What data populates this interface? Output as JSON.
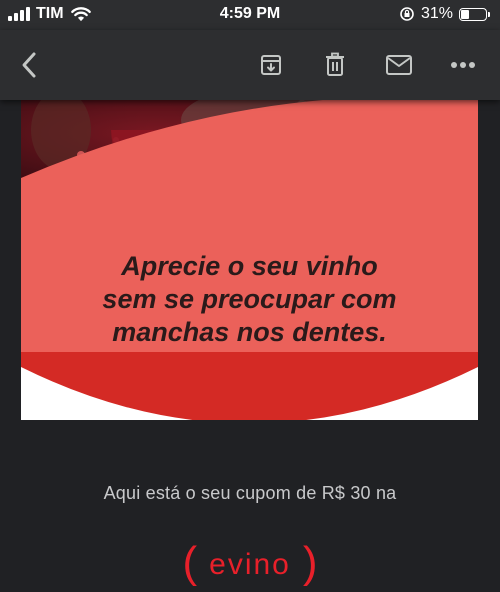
{
  "status_bar": {
    "carrier": "TIM",
    "time": "4:59 PM",
    "battery": "31%",
    "icons": [
      "signal-icon",
      "wifi-icon",
      "rotation-lock-icon",
      "battery-icon"
    ]
  },
  "toolbar": {
    "icons": [
      "back-arrow-icon",
      "archive-icon",
      "trash-icon",
      "mail-icon",
      "more-icon"
    ]
  },
  "email": {
    "headline_lines": [
      "Aprecie o seu vinho",
      "sem se preocupar com",
      "manchas nos dentes."
    ],
    "coupon_text": "Aqui está o seu cupom de R$ 30 na",
    "logo_text": "evino",
    "logo_open": "(",
    "logo_close": ")"
  },
  "colors": {
    "background": "#202124",
    "toolbar": "#2d2e30",
    "banner_coral": "#eb615a",
    "banner_red": "#d42a25",
    "brand_red": "#e8202a"
  }
}
